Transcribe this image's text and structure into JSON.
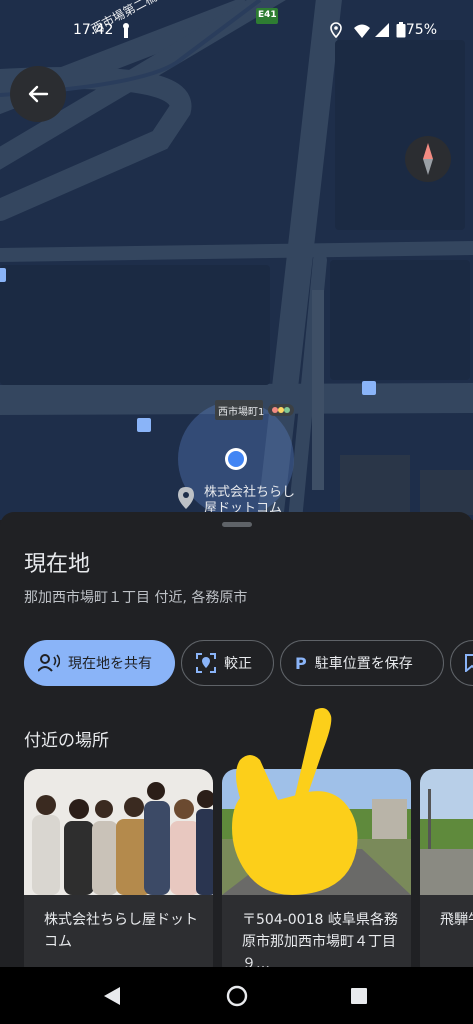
{
  "status_bar": {
    "time": "17:42",
    "battery": "75%"
  },
  "map": {
    "street_label_top": "西市場第二橋",
    "route_shield": "E41",
    "intersection_label": "西市場町1",
    "poi_label_line1": "株式会社ちらし",
    "poi_label_line2": "屋ドットコム"
  },
  "sheet": {
    "title": "現在地",
    "subtitle": "那加西市場町１丁目 付近, 各務原市",
    "actions": [
      {
        "label": "現在地を共有",
        "icon": "share-location-icon"
      },
      {
        "label": "較正",
        "icon": "calibrate-icon"
      },
      {
        "label": "駐車位置を保存",
        "icon": "parking-icon"
      }
    ],
    "nearby_title": "付近の場所",
    "nearby": [
      {
        "text": "株式会社ちらし屋ドットコム"
      },
      {
        "text": "〒504-0018 岐阜県各務原市那加西市場町４丁目９…"
      },
      {
        "text": "飛騨牛ター"
      }
    ]
  },
  "colors": {
    "accent": "#8ab4f8",
    "map_bg": "#1e2e4a",
    "sheet_bg": "#202124"
  }
}
